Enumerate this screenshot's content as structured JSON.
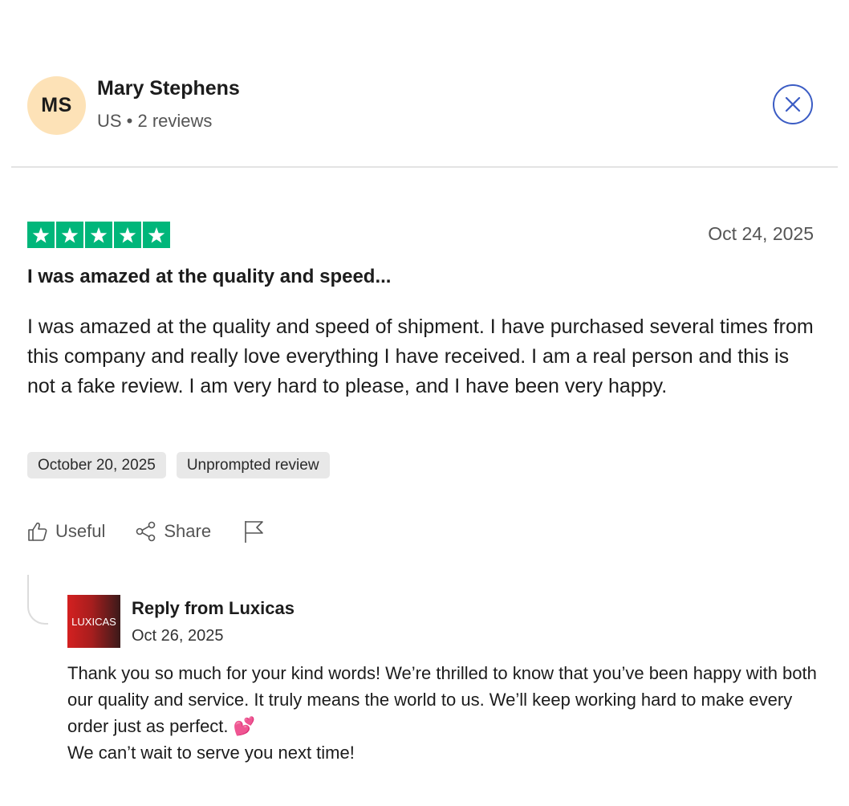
{
  "reviewer": {
    "initials": "MS",
    "name": "Mary Stephens",
    "meta": "US • 2 reviews"
  },
  "close_icon": "close-icon",
  "review": {
    "rating": 5,
    "rating_max": 5,
    "star_color": "#00b67a",
    "date": "Oct 24, 2025",
    "title": "I was amazed at the quality and speed...",
    "body": "I was amazed at the quality and speed of shipment. I have purchased several times from this company and really love everything I have received. I am a real person and this is not a fake review. I am very hard to please, and I have been very happy.",
    "tags": [
      "October 20, 2025",
      "Unprompted review"
    ]
  },
  "actions": {
    "useful_label": "Useful",
    "share_label": "Share",
    "useful_icon": "thumbs-up-icon",
    "share_icon": "share-icon",
    "flag_icon": "flag-icon"
  },
  "reply": {
    "logo_text": "LUXICAS",
    "from": "Reply from Luxicas",
    "date": "Oct 26, 2025",
    "body_line1": "Thank you so much for your kind words! We’re thrilled to know that you’ve been happy with both our quality and service. It truly means the world to us. We’ll keep working hard to make every order just as perfect.",
    "emoji": "💕",
    "body_line2": "We can’t wait to serve you next time!"
  }
}
